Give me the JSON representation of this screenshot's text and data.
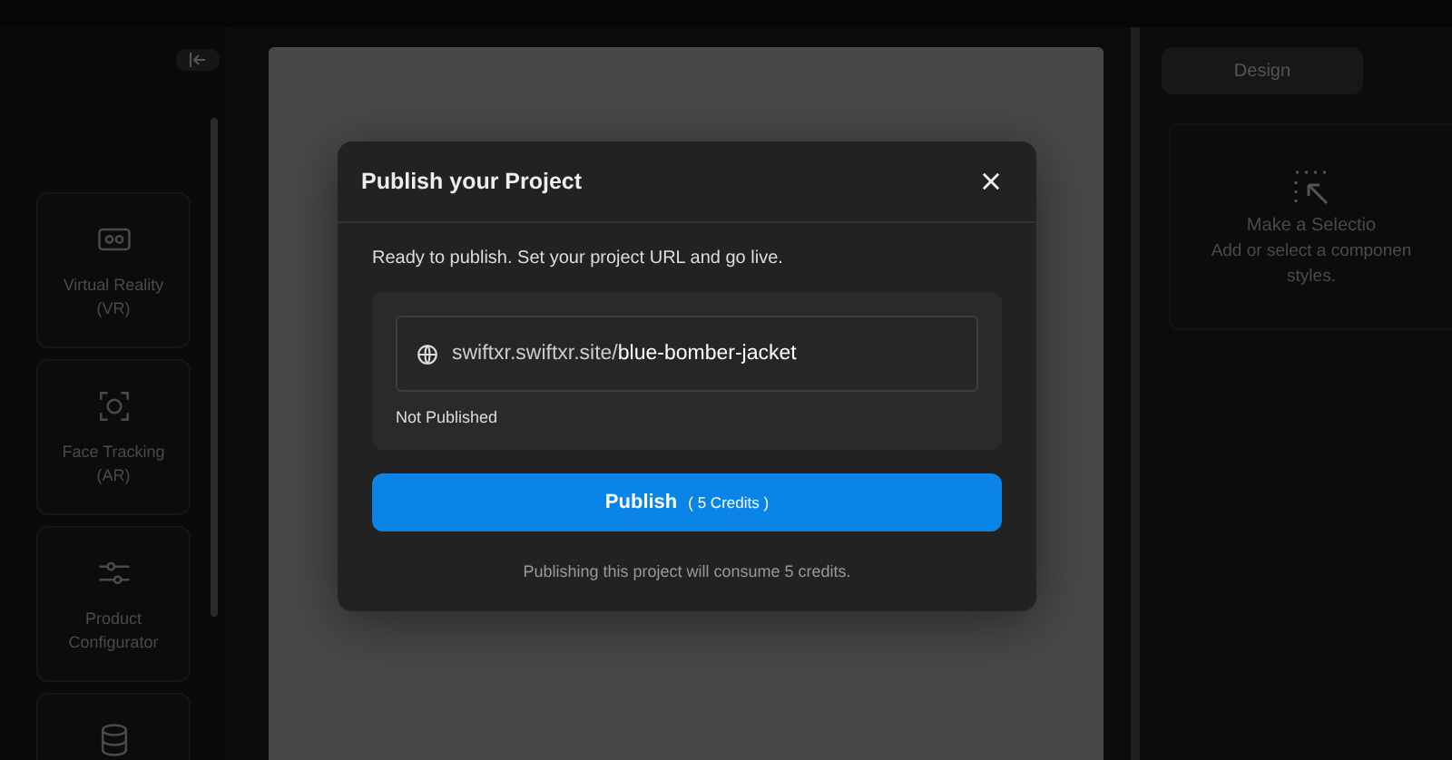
{
  "sidebar": {
    "cards": [
      {
        "kind": "vr",
        "label": "Virtual Reality (VR)"
      },
      {
        "kind": "face",
        "label": "Face Tracking (AR)"
      },
      {
        "kind": "sliders",
        "label": "Product Configurator"
      },
      {
        "kind": "database"
      }
    ]
  },
  "inspector": {
    "tab": "Design",
    "empty_title": "Make a Selectio",
    "empty_text": "Add or select a componen",
    "empty_text_2": "styles."
  },
  "dialog": {
    "title": "Publish your Project",
    "intro": "Ready to publish. Set your project URL and go live.",
    "url_prefix": "swiftxr.swiftxr.site/",
    "url_slug": "blue-bomber-jacket",
    "status": "Not Published",
    "button_label": "Publish",
    "button_credits": "( 5 Credits )",
    "note": "Publishing this project will consume 5 credits."
  }
}
